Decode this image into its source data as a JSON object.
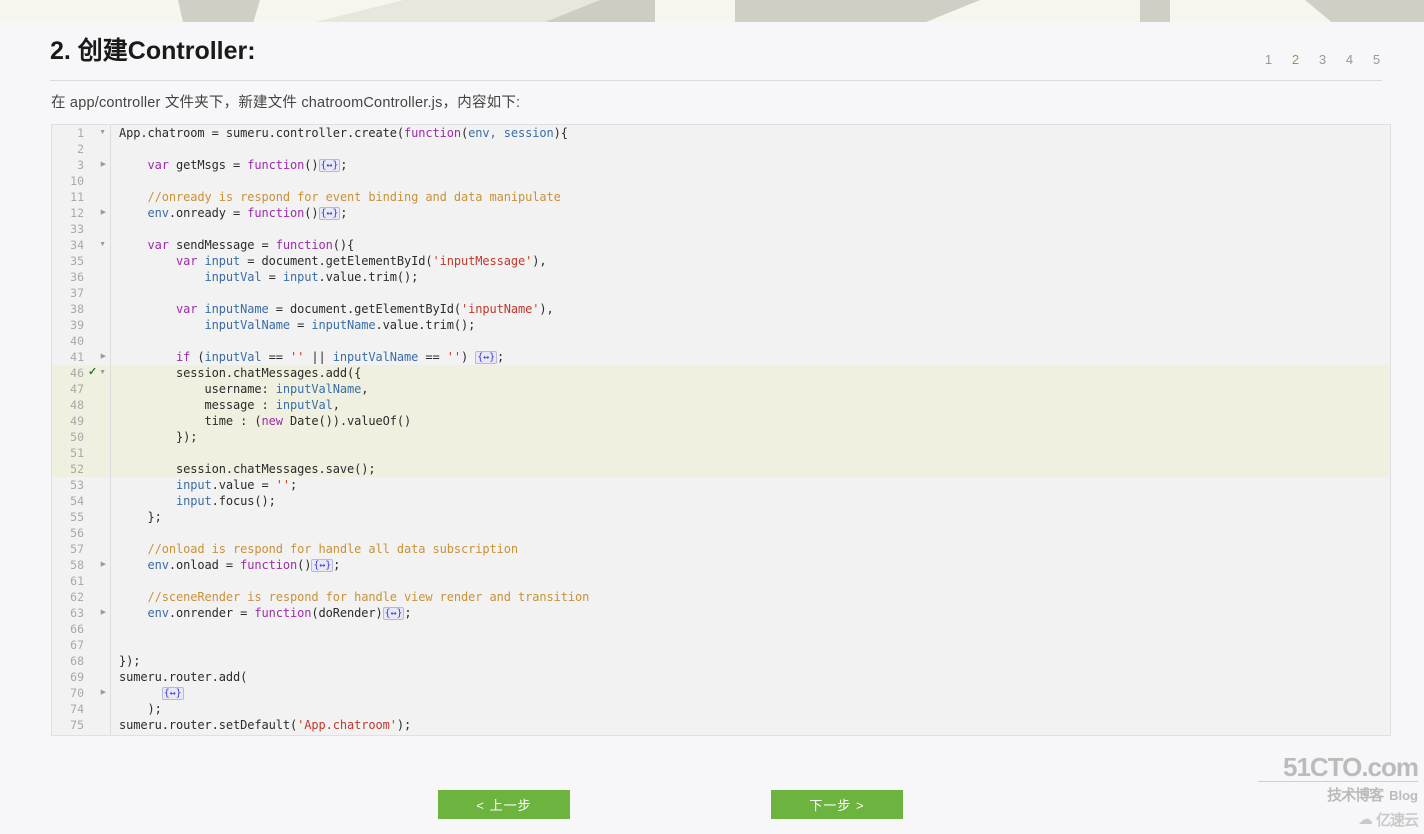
{
  "header": {
    "title": "2. 创建Controller:",
    "intro": "在 app/controller 文件夹下，新建文件 chatroomController.js，内容如下:"
  },
  "pagination": {
    "pages": [
      "1",
      "2",
      "3",
      "4",
      "5"
    ],
    "active": "2",
    "active_color": "#6cb33f"
  },
  "code": {
    "language": "javascript",
    "highlight_color": "#f0f0e0",
    "background": "#f2f2f2",
    "lines": [
      {
        "num": "1",
        "marker": "expanded",
        "highlight": false,
        "tokens": [
          {
            "t": "App.chatroom = sumeru.controller.create(",
            "c": "plain"
          },
          {
            "t": "function",
            "c": "kw"
          },
          {
            "t": "(",
            "c": "plain"
          },
          {
            "t": "env, session",
            "c": "id"
          },
          {
            "t": "){",
            "c": "plain"
          }
        ]
      },
      {
        "num": "2",
        "marker": "",
        "highlight": false,
        "tokens": []
      },
      {
        "num": "3",
        "marker": "collapsed",
        "highlight": false,
        "tokens": [
          {
            "t": "    ",
            "c": "plain"
          },
          {
            "t": "var",
            "c": "kw"
          },
          {
            "t": " getMsgs = ",
            "c": "plain"
          },
          {
            "t": "function",
            "c": "kw"
          },
          {
            "t": "()",
            "c": "plain"
          },
          {
            "t": "{↔}",
            "c": "foldbox"
          },
          {
            "t": ";",
            "c": "plain"
          }
        ]
      },
      {
        "num": "10",
        "marker": "",
        "highlight": false,
        "tokens": []
      },
      {
        "num": "11",
        "marker": "",
        "highlight": false,
        "tokens": [
          {
            "t": "    ",
            "c": "plain"
          },
          {
            "t": "//onready is respond for event binding and data manipulate",
            "c": "cmt"
          }
        ]
      },
      {
        "num": "12",
        "marker": "collapsed",
        "highlight": false,
        "tokens": [
          {
            "t": "    ",
            "c": "plain"
          },
          {
            "t": "env",
            "c": "id"
          },
          {
            "t": ".onready = ",
            "c": "plain"
          },
          {
            "t": "function",
            "c": "kw"
          },
          {
            "t": "()",
            "c": "plain"
          },
          {
            "t": "{↔}",
            "c": "foldbox"
          },
          {
            "t": ";",
            "c": "plain"
          }
        ]
      },
      {
        "num": "33",
        "marker": "",
        "highlight": false,
        "tokens": []
      },
      {
        "num": "34",
        "marker": "expanded",
        "highlight": false,
        "tokens": [
          {
            "t": "    ",
            "c": "plain"
          },
          {
            "t": "var",
            "c": "kw"
          },
          {
            "t": " sendMessage = ",
            "c": "plain"
          },
          {
            "t": "function",
            "c": "kw"
          },
          {
            "t": "(){",
            "c": "plain"
          }
        ]
      },
      {
        "num": "35",
        "marker": "",
        "highlight": false,
        "tokens": [
          {
            "t": "        ",
            "c": "plain"
          },
          {
            "t": "var",
            "c": "kw"
          },
          {
            "t": " ",
            "c": "plain"
          },
          {
            "t": "input",
            "c": "id"
          },
          {
            "t": " = document.getElementById(",
            "c": "plain"
          },
          {
            "t": "'inputMessage'",
            "c": "str"
          },
          {
            "t": "),",
            "c": "plain"
          }
        ]
      },
      {
        "num": "36",
        "marker": "",
        "highlight": false,
        "tokens": [
          {
            "t": "            ",
            "c": "plain"
          },
          {
            "t": "inputVal",
            "c": "id"
          },
          {
            "t": " = ",
            "c": "plain"
          },
          {
            "t": "input",
            "c": "id"
          },
          {
            "t": ".value.trim();",
            "c": "plain"
          }
        ]
      },
      {
        "num": "37",
        "marker": "",
        "highlight": false,
        "tokens": []
      },
      {
        "num": "38",
        "marker": "",
        "highlight": false,
        "tokens": [
          {
            "t": "        ",
            "c": "plain"
          },
          {
            "t": "var",
            "c": "kw"
          },
          {
            "t": " ",
            "c": "plain"
          },
          {
            "t": "inputName",
            "c": "id"
          },
          {
            "t": " = document.getElementById(",
            "c": "plain"
          },
          {
            "t": "'inputName'",
            "c": "str"
          },
          {
            "t": "),",
            "c": "plain"
          }
        ]
      },
      {
        "num": "39",
        "marker": "",
        "highlight": false,
        "tokens": [
          {
            "t": "            ",
            "c": "plain"
          },
          {
            "t": "inputValName",
            "c": "id"
          },
          {
            "t": " = ",
            "c": "plain"
          },
          {
            "t": "inputName",
            "c": "id"
          },
          {
            "t": ".value.trim();",
            "c": "plain"
          }
        ]
      },
      {
        "num": "40",
        "marker": "",
        "highlight": false,
        "tokens": []
      },
      {
        "num": "41",
        "marker": "collapsed",
        "highlight": false,
        "tokens": [
          {
            "t": "        ",
            "c": "plain"
          },
          {
            "t": "if",
            "c": "kw"
          },
          {
            "t": " (",
            "c": "plain"
          },
          {
            "t": "inputVal",
            "c": "id"
          },
          {
            "t": " == ",
            "c": "plain"
          },
          {
            "t": "''",
            "c": "str"
          },
          {
            "t": " || ",
            "c": "plain"
          },
          {
            "t": "inputValName",
            "c": "id"
          },
          {
            "t": " == ",
            "c": "plain"
          },
          {
            "t": "''",
            "c": "str"
          },
          {
            "t": ") ",
            "c": "plain"
          },
          {
            "t": "{↔}",
            "c": "foldbox"
          },
          {
            "t": ";",
            "c": "plain"
          }
        ]
      },
      {
        "num": "46",
        "marker": "check-expanded",
        "highlight": true,
        "tokens": [
          {
            "t": "        session.chatMessages.add({",
            "c": "plain"
          }
        ]
      },
      {
        "num": "47",
        "marker": "",
        "highlight": true,
        "tokens": [
          {
            "t": "            username: ",
            "c": "plain"
          },
          {
            "t": "inputValName",
            "c": "id"
          },
          {
            "t": ",",
            "c": "plain"
          }
        ]
      },
      {
        "num": "48",
        "marker": "",
        "highlight": true,
        "tokens": [
          {
            "t": "            message : ",
            "c": "plain"
          },
          {
            "t": "inputVal",
            "c": "id"
          },
          {
            "t": ",",
            "c": "plain"
          }
        ]
      },
      {
        "num": "49",
        "marker": "",
        "highlight": true,
        "tokens": [
          {
            "t": "            time : (",
            "c": "plain"
          },
          {
            "t": "new",
            "c": "kw"
          },
          {
            "t": " Date()).valueOf()",
            "c": "plain"
          }
        ]
      },
      {
        "num": "50",
        "marker": "",
        "highlight": true,
        "tokens": [
          {
            "t": "        });",
            "c": "plain"
          }
        ]
      },
      {
        "num": "51",
        "marker": "",
        "highlight": true,
        "tokens": []
      },
      {
        "num": "52",
        "marker": "",
        "highlight": true,
        "tokens": [
          {
            "t": "        session.chatMessages.save();",
            "c": "plain"
          }
        ]
      },
      {
        "num": "53",
        "marker": "",
        "highlight": false,
        "tokens": [
          {
            "t": "        ",
            "c": "plain"
          },
          {
            "t": "input",
            "c": "id"
          },
          {
            "t": ".value = ",
            "c": "plain"
          },
          {
            "t": "''",
            "c": "str"
          },
          {
            "t": ";",
            "c": "plain"
          }
        ]
      },
      {
        "num": "54",
        "marker": "",
        "highlight": false,
        "tokens": [
          {
            "t": "        ",
            "c": "plain"
          },
          {
            "t": "input",
            "c": "id"
          },
          {
            "t": ".focus();",
            "c": "plain"
          }
        ]
      },
      {
        "num": "55",
        "marker": "",
        "highlight": false,
        "tokens": [
          {
            "t": "    };",
            "c": "plain"
          }
        ]
      },
      {
        "num": "56",
        "marker": "",
        "highlight": false,
        "tokens": []
      },
      {
        "num": "57",
        "marker": "",
        "highlight": false,
        "tokens": [
          {
            "t": "    ",
            "c": "plain"
          },
          {
            "t": "//onload is respond for handle all data subscription",
            "c": "cmt"
          }
        ]
      },
      {
        "num": "58",
        "marker": "collapsed",
        "highlight": false,
        "tokens": [
          {
            "t": "    ",
            "c": "plain"
          },
          {
            "t": "env",
            "c": "id"
          },
          {
            "t": ".onload = ",
            "c": "plain"
          },
          {
            "t": "function",
            "c": "kw"
          },
          {
            "t": "()",
            "c": "plain"
          },
          {
            "t": "{↔}",
            "c": "foldbox"
          },
          {
            "t": ";",
            "c": "plain"
          }
        ]
      },
      {
        "num": "61",
        "marker": "",
        "highlight": false,
        "tokens": []
      },
      {
        "num": "62",
        "marker": "",
        "highlight": false,
        "tokens": [
          {
            "t": "    ",
            "c": "plain"
          },
          {
            "t": "//sceneRender is respond for handle view render and transition",
            "c": "cmt"
          }
        ]
      },
      {
        "num": "63",
        "marker": "collapsed",
        "highlight": false,
        "tokens": [
          {
            "t": "    ",
            "c": "plain"
          },
          {
            "t": "env",
            "c": "id"
          },
          {
            "t": ".onrender = ",
            "c": "plain"
          },
          {
            "t": "function",
            "c": "kw"
          },
          {
            "t": "(doRender)",
            "c": "plain"
          },
          {
            "t": "{↔}",
            "c": "foldbox"
          },
          {
            "t": ";",
            "c": "plain"
          }
        ]
      },
      {
        "num": "66",
        "marker": "",
        "highlight": false,
        "tokens": []
      },
      {
        "num": "67",
        "marker": "",
        "highlight": false,
        "tokens": []
      },
      {
        "num": "68",
        "marker": "",
        "highlight": false,
        "tokens": [
          {
            "t": "});",
            "c": "plain"
          }
        ]
      },
      {
        "num": "69",
        "marker": "",
        "highlight": false,
        "tokens": [
          {
            "t": "sumeru.router.add(",
            "c": "plain"
          }
        ]
      },
      {
        "num": "70",
        "marker": "collapsed",
        "highlight": false,
        "tokens": [
          {
            "t": "      ",
            "c": "plain"
          },
          {
            "t": "{↔}",
            "c": "foldbox"
          }
        ]
      },
      {
        "num": "74",
        "marker": "",
        "highlight": false,
        "tokens": [
          {
            "t": "    );",
            "c": "plain"
          }
        ]
      },
      {
        "num": "75",
        "marker": "",
        "highlight": false,
        "tokens": [
          {
            "t": "sumeru.router.setDefault(",
            "c": "plain"
          },
          {
            "t": "'App.chatroom'",
            "c": "str"
          },
          {
            "t": ");",
            "c": "plain"
          }
        ]
      }
    ]
  },
  "footer": {
    "prev_label": "< 上一步",
    "next_label": "下一步 >",
    "button_color": "#6cb33f"
  },
  "watermark": {
    "main": "51CTO.com",
    "cn": "技术博客",
    "blog": "Blog",
    "cloud_icon": "cloud-icon",
    "yisu": "亿速云"
  }
}
